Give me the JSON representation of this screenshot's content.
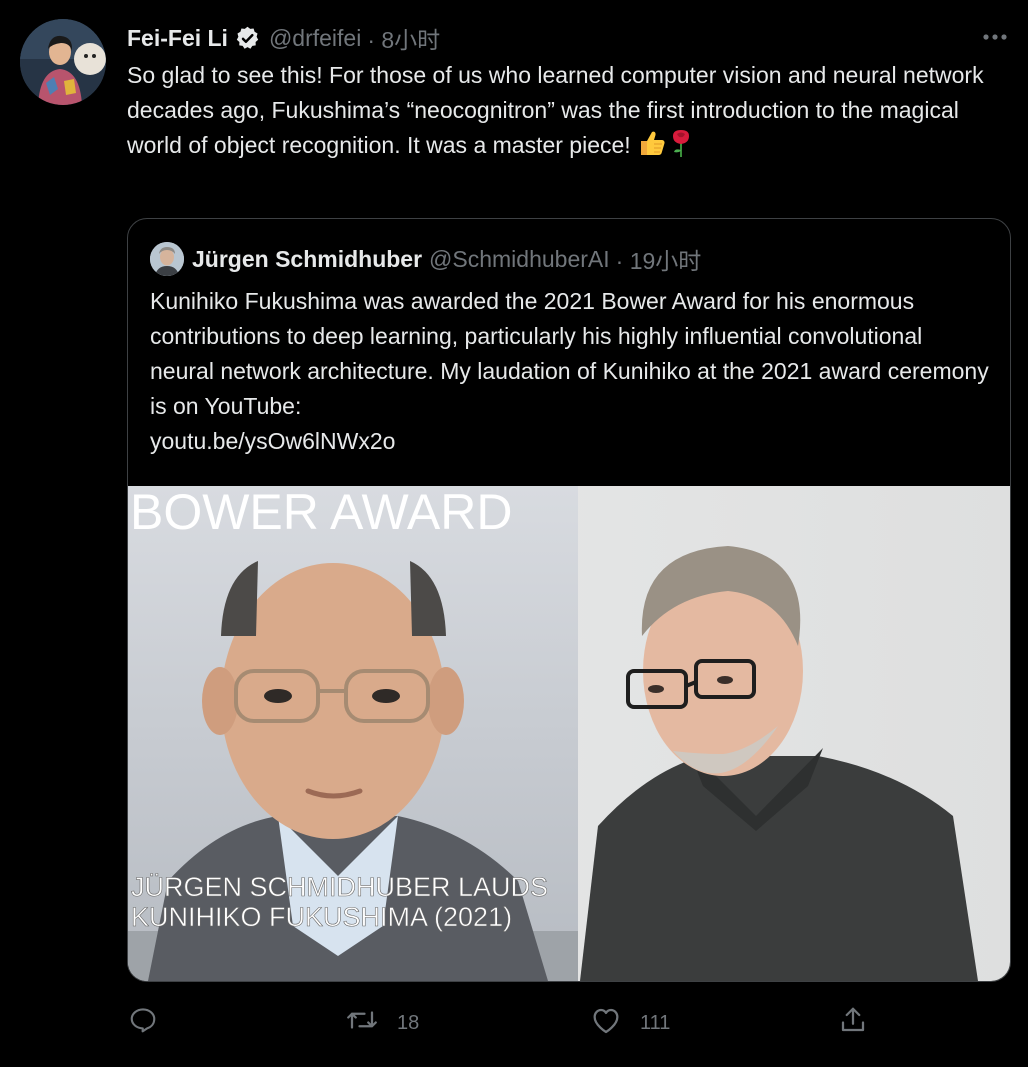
{
  "tweet": {
    "author_name": "Fei-Fei Li",
    "author_handle": "@drfeifei",
    "time": "· 8小时",
    "text": "So glad to see this! For those of us who learned computer vision and neural network decades ago, Fukushima’s “neocognitron” was the first introduction to the magical world of object recognition. It was a master piece! ",
    "emojis": [
      "thumbs-up-icon",
      "rose-icon"
    ]
  },
  "quote": {
    "author_name": "Jürgen Schmidhuber",
    "author_handle": "@SchmidhuberAI",
    "time": "· 19小时",
    "text": "Kunihiko Fukushima was awarded the 2021 Bower Award for his enormous contributions to deep learning, particularly his highly influential convolutional neural network architecture. My laudation of Kunihiko at the 2021 award ceremony is on YouTube:",
    "link": "youtu.be/ysOw6lNWx2o",
    "media": {
      "title": "BOWER AWARD",
      "caption_line1": "JÜRGEN SCHMIDHUBER LAUDS",
      "caption_line2": "KUNIHIKO FUKUSHIMA (2021)"
    }
  },
  "actions": {
    "reply_icon": "reply-icon",
    "retweet_icon": "retweet-icon",
    "retweet_count": "18",
    "like_icon": "heart-icon",
    "like_count": "111",
    "share_icon": "share-icon"
  },
  "colors": {
    "background": "#000000",
    "text": "#e7e9ea",
    "muted": "#71767b",
    "border": "#3e4144"
  }
}
